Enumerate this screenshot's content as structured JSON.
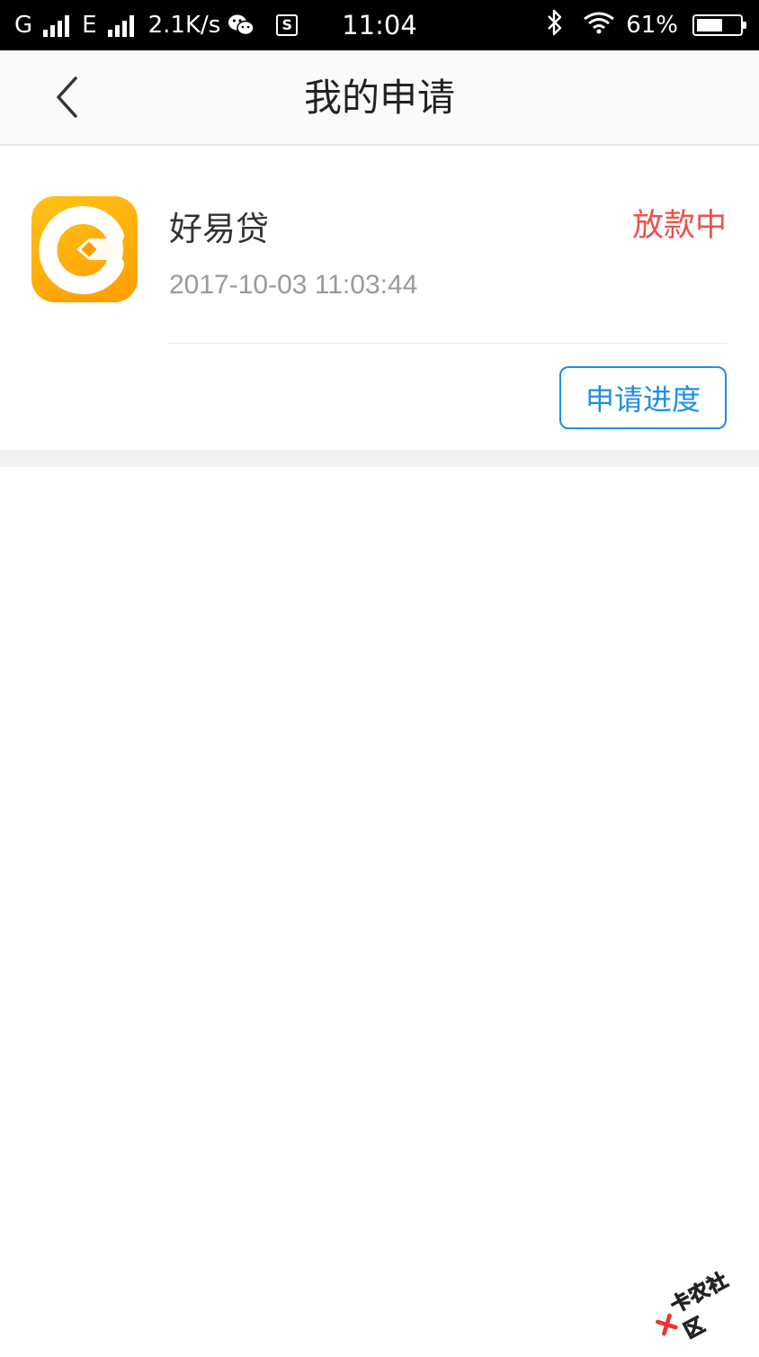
{
  "status_bar": {
    "carrier1": "G",
    "carrier2": "E",
    "speed": "2.1K/s",
    "time": "11:04",
    "battery": "61%",
    "battery_level": 0.61,
    "icons": [
      "signal-icon",
      "wechat-icon",
      "s-app-icon",
      "bluetooth-icon",
      "wifi-icon",
      "battery-icon"
    ]
  },
  "nav": {
    "title": "我的申请",
    "back_icon": "chevron-left-icon"
  },
  "application": {
    "name": "好易贷",
    "datetime": "2017-10-03 11:03:44",
    "status": "放款中",
    "status_color": "#f0504a",
    "action_label": "申请进度",
    "action_color": "#1e8fe1",
    "icon": "haoyidai-logo-icon"
  },
  "watermark": {
    "text": "卡农社区"
  }
}
